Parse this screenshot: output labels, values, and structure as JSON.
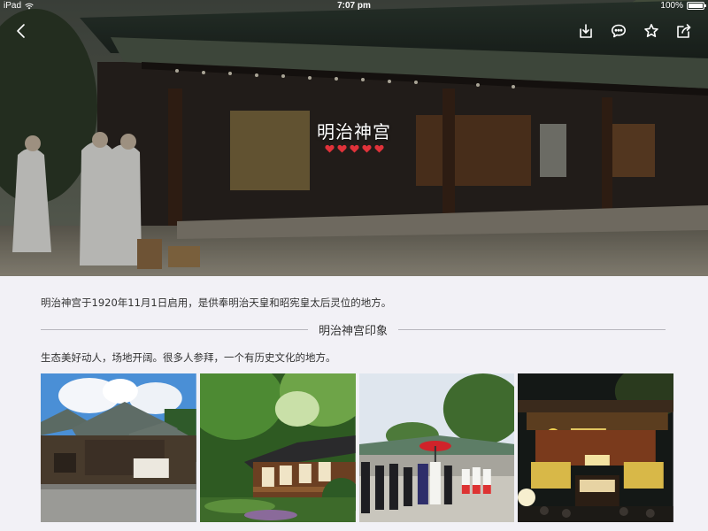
{
  "status": {
    "device": "iPad",
    "time": "7:07 pm",
    "battery": "100%"
  },
  "hero": {
    "title": "明治神宫",
    "rating": 5,
    "heart_color": "#e0323a"
  },
  "content": {
    "intro": "明治神宫于1920年11月1日启用，是供奉明治天皇和昭宪皇太后灵位的地方。",
    "section_title": "明治神宫印象",
    "description": "生态美好动人，场地开阔。很多人参拜，一个有历史文化的地方。"
  },
  "icons": {
    "back": "chevron-left-icon",
    "download": "download-icon",
    "comment": "comment-icon",
    "favorite": "star-icon",
    "share": "share-icon"
  }
}
